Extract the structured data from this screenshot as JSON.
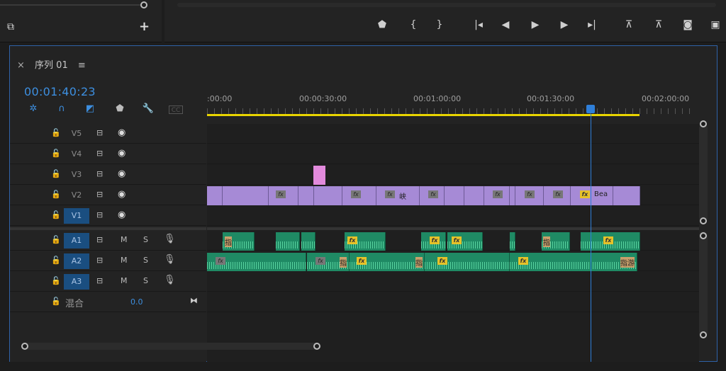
{
  "sequence": {
    "tab_name": "序列 01",
    "timecode": "00:01:40:23"
  },
  "ruler": {
    "labels": [
      ":00:00",
      "00:00:30:00",
      "00:01:00:00",
      "00:01:30:00",
      "00:02:00:00"
    ]
  },
  "tracks": {
    "video": [
      {
        "name": "V5"
      },
      {
        "name": "V4"
      },
      {
        "name": "V3"
      },
      {
        "name": "V2"
      },
      {
        "name": "V1"
      }
    ],
    "audio": [
      {
        "name": "A1",
        "m": "M",
        "s": "S"
      },
      {
        "name": "A2",
        "m": "M",
        "s": "S"
      },
      {
        "name": "A3",
        "m": "M",
        "s": "S"
      }
    ],
    "mix": {
      "label": "混合",
      "value": "0.0"
    }
  },
  "clips": {
    "v2_label_1": "峡",
    "v2_label_2": "Bea",
    "a1_label": "指",
    "a1_label2": "指",
    "a2_label1": "指",
    "a2_label2": "指",
    "a2_label3": "指游"
  },
  "icons": {
    "close": "close-icon",
    "menu": "hamburger-icon",
    "add": "plus-icon",
    "marker": "marker-icon",
    "in": "mark-in-icon",
    "out": "mark-out-icon",
    "go_in": "go-to-in-icon",
    "step_back": "step-back-icon",
    "play": "play-icon",
    "step_fwd": "step-forward-icon",
    "go_out": "go-to-out-icon",
    "lift": "lift-icon",
    "extract": "extract-icon",
    "camera": "export-frame-icon"
  },
  "colors": {
    "accent": "#3d8fe0",
    "playhead": "#2f7fd9",
    "video_clip": "#a68ad6",
    "audio_clip": "#1f8a64",
    "work_area": "#e8d400"
  }
}
